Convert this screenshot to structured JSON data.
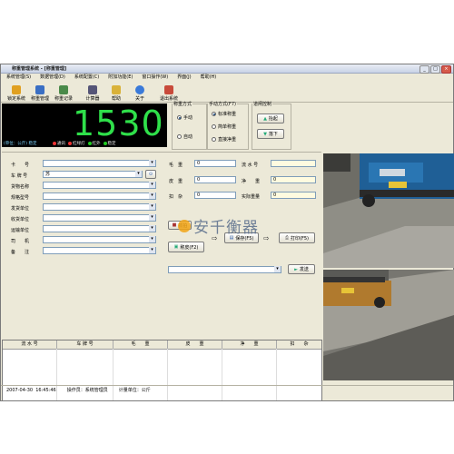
{
  "window": {
    "title": "称重管理系统 - [称重管理]"
  },
  "menu": [
    "系统管理(S)",
    "数据管理(D)",
    "系统配置(C)",
    "附加功能(E)",
    "窗口操作(W)",
    "界面(J)",
    "帮助(H)"
  ],
  "toolbar": [
    {
      "label": "锁定系统",
      "icon": "lock-icon"
    },
    {
      "label": "称重管理",
      "icon": "weigh-icon"
    },
    {
      "label": "称重记录",
      "icon": "records-icon"
    },
    {
      "label": "计算器",
      "icon": "calculator-icon"
    },
    {
      "label": "帮助",
      "icon": "help-icon"
    },
    {
      "label": "关于",
      "icon": "about-icon"
    },
    {
      "label": "退出系统",
      "icon": "exit-icon"
    }
  ],
  "display": {
    "weight": "1530",
    "unit": "(单位：公斤) 稳定",
    "status": [
      {
        "label": "通讯",
        "color": "#e33"
      },
      {
        "label": "红绿灯",
        "color": "#e33"
      },
      {
        "label": "红外",
        "color": "#2c2"
      },
      {
        "label": "稳定",
        "color": "#2c2"
      }
    ]
  },
  "weigh_mode": {
    "legend": "称重方式",
    "options": [
      "手动",
      "自动"
    ],
    "selected": "手动"
  },
  "manual_mode": {
    "legend": "手动方式(F7)",
    "options": [
      "标准称重",
      "简单称重",
      "直接净重"
    ],
    "selected": "标准称重"
  },
  "gate": {
    "legend": "道闸控制",
    "raise": "抬起",
    "lower": "落下"
  },
  "form": {
    "labels": [
      "卡　　号",
      "车 牌 号",
      "货物名称",
      "规格型号",
      "发货单位",
      "收货单位",
      "运输单位",
      "司　　机",
      "备　　注"
    ],
    "plate_value": "苏"
  },
  "weights": {
    "labels": [
      "毛　重",
      "皮　重",
      "扣　杂"
    ],
    "values": [
      "0",
      "0",
      "0"
    ],
    "right_labels": [
      "流 水 号",
      "净　　重",
      "实际重量"
    ],
    "right_values": [
      "",
      "0",
      "0"
    ]
  },
  "actions": {
    "snapshot": "抓拍",
    "reset": "称皮(F2)",
    "save": "保存(F5)",
    "print": "打印(F5)",
    "send": "发送"
  },
  "grid": {
    "headers": [
      "流 水 号",
      "车 牌 号",
      "毛　　重",
      "皮　　重",
      "净　　重",
      "扣　　杂"
    ]
  },
  "statusbar": {
    "date": "2007-04-30",
    "time": "16:45:46",
    "operator": "操作员：系统管理员",
    "unit": "计量单位：公斤"
  },
  "watermark": "安千衡器"
}
